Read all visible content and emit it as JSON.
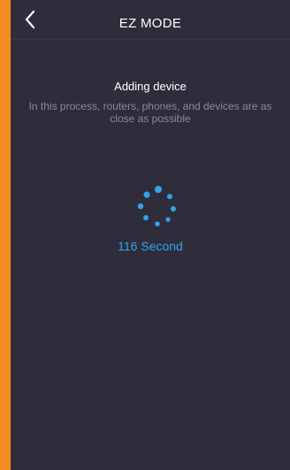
{
  "nav": {
    "title": "EZ MODE",
    "back_icon": "chevron-left-icon"
  },
  "content": {
    "heading": "Adding device",
    "description": "In this process, routers, phones, and devices are as close as possible",
    "spinner_icon": "loading-spinner-icon",
    "countdown_value": "116",
    "countdown_unit": "Second",
    "countdown_text": "116 Second"
  },
  "colors": {
    "frame": "#f58a23",
    "background": "#2f2d3c",
    "accent": "#2ea7e8",
    "muted_text": "#8a889a"
  }
}
